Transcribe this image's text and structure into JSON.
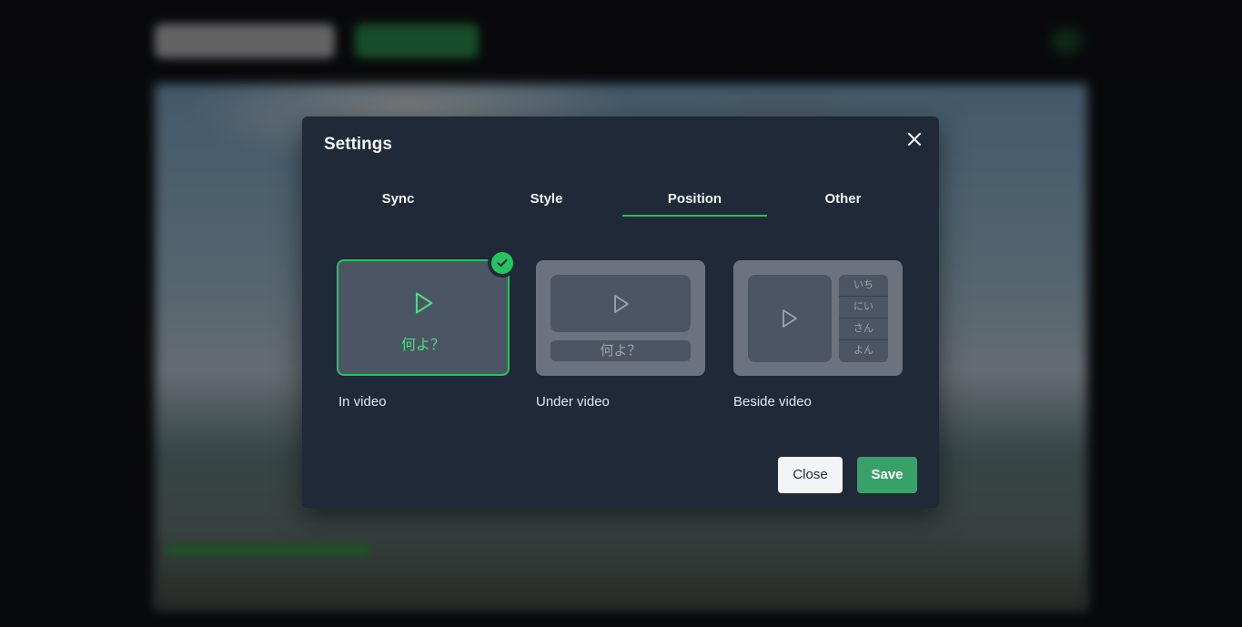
{
  "modal": {
    "title": "Settings",
    "close_icon": "close-icon"
  },
  "tabs": [
    {
      "label": "Sync",
      "active": false
    },
    {
      "label": "Style",
      "active": false
    },
    {
      "label": "Position",
      "active": true
    },
    {
      "label": "Other",
      "active": false
    }
  ],
  "position_options": [
    {
      "label": "In video",
      "selected": true,
      "caption": "何よ？"
    },
    {
      "label": "Under video",
      "selected": false,
      "caption": "何よ？"
    },
    {
      "label": "Beside video",
      "selected": false,
      "list": [
        "いち",
        "にい",
        "さん",
        "よん"
      ]
    }
  ],
  "buttons": {
    "close_label": "Close",
    "save_label": "Save"
  },
  "colors": {
    "accent": "#22c55e",
    "modal_bg": "#1f2937",
    "save_button": "#38a169"
  },
  "icons": {
    "selected": "check-icon",
    "preview": "play-icon"
  }
}
